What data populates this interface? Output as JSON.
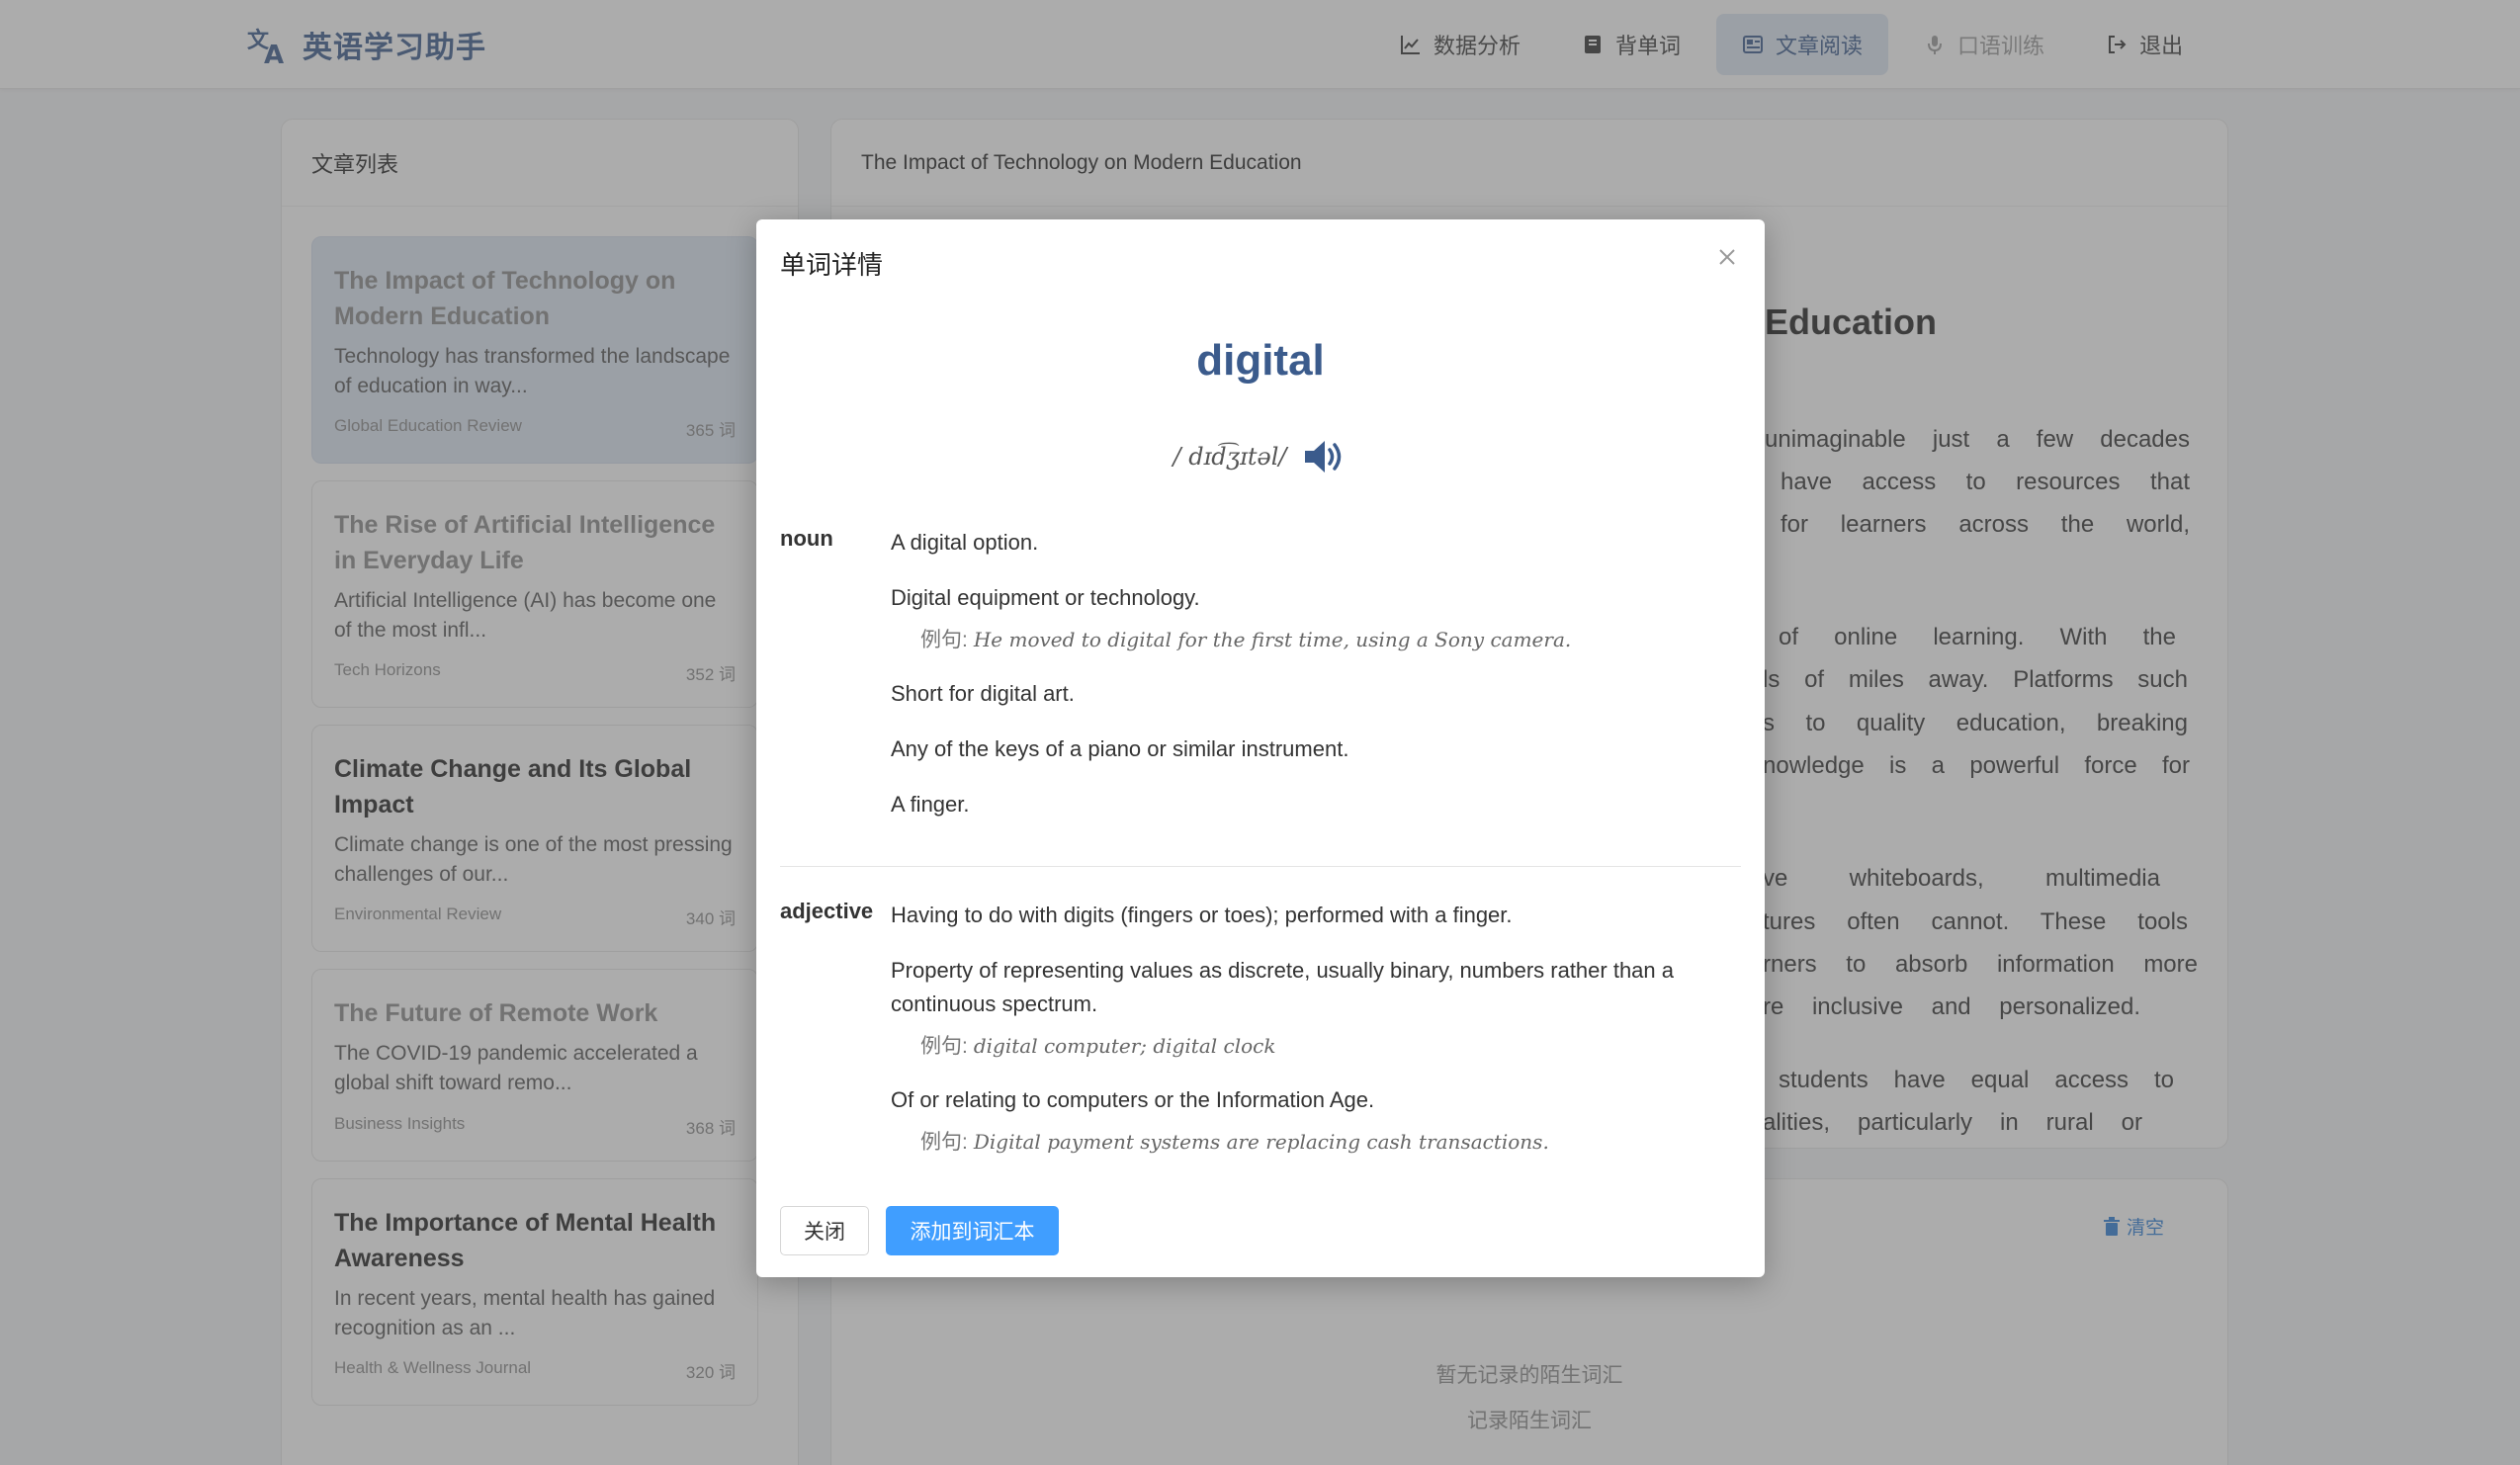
{
  "header": {
    "brand": "英语学习助手",
    "nav": [
      {
        "label": "数据分析",
        "icon": "chart-line-icon",
        "state": "normal"
      },
      {
        "label": "背单词",
        "icon": "book-icon",
        "state": "normal"
      },
      {
        "label": "文章阅读",
        "icon": "newspaper-icon",
        "state": "active"
      },
      {
        "label": "口语训练",
        "icon": "microphone-icon",
        "state": "disabled"
      },
      {
        "label": "退出",
        "icon": "logout-icon",
        "state": "normal"
      }
    ]
  },
  "article_list": {
    "title": "文章列表",
    "items": [
      {
        "title": "The Impact of Technology on Modern Education",
        "excerpt": "Technology has transformed the landscape of education in way...",
        "source": "Global Education Review",
        "words": "365 词"
      },
      {
        "title": "The Rise of Artificial Intelligence in Everyday Life",
        "excerpt": "Artificial Intelligence (AI) has become one of the most infl...",
        "source": "Tech Horizons",
        "words": "352 词"
      },
      {
        "title": "Climate Change and Its Global Impact",
        "excerpt": "Climate change is one of the most pressing challenges of our...",
        "source": "Environmental Review",
        "words": "340 词"
      },
      {
        "title": "The Future of Remote Work",
        "excerpt": "The COVID-19 pandemic accelerated a global shift toward remo...",
        "source": "Business Insights",
        "words": "368 词"
      },
      {
        "title": "The Importance of Mental Health Awareness",
        "excerpt": "In recent years, mental health has gained recognition as an ...",
        "source": "Health & Wellness Journal",
        "words": "320 词"
      }
    ]
  },
  "reader": {
    "header_title": "The Impact of Technology on Modern Education",
    "title_visible": "Education",
    "lines": [
      "unimaginable just a few decades",
      "have access to resources that",
      "for learners across the world,",
      "of online learning. With the",
      "ls of miles away. Platforms such",
      "s to quality education, breaking",
      "nowledge is a powerful force for",
      "ve whiteboards, multimedia",
      "tures often cannot. These tools",
      "rners to absorb information more",
      "re inclusive and personalized.",
      "students have equal access to",
      "alities, particularly in rural or"
    ]
  },
  "vocab": {
    "clear_label": "清空",
    "empty_text": "暂无记录的陌生词汇",
    "hint_text": "记录陌生词汇"
  },
  "modal": {
    "title": "单词详情",
    "word": "digital",
    "phonetic": "/ dɪd͡ʒɪtəl/",
    "noun": {
      "label": "noun",
      "definitions": [
        {
          "text": "A digital option."
        },
        {
          "text": "Digital equipment or technology.",
          "example": "He moved to digital for the first time, using a Sony camera."
        },
        {
          "text": "Short for digital art."
        },
        {
          "text": "Any of the keys of a piano or similar instrument."
        },
        {
          "text": "A finger."
        }
      ]
    },
    "adjective": {
      "label": "adjective",
      "definitions": [
        {
          "text": "Having to do with digits (fingers or toes); performed with a finger."
        },
        {
          "text": "Property of representing values as discrete, usually binary, numbers rather than a continuous spectrum.",
          "example": "digital computer;  digital clock"
        },
        {
          "text": "Of or relating to computers or the Information Age.",
          "example": "Digital payment systems are replacing cash transactions."
        }
      ]
    },
    "example_label": "例句:",
    "close_label": "关闭",
    "add_label": "添加到词汇本"
  }
}
